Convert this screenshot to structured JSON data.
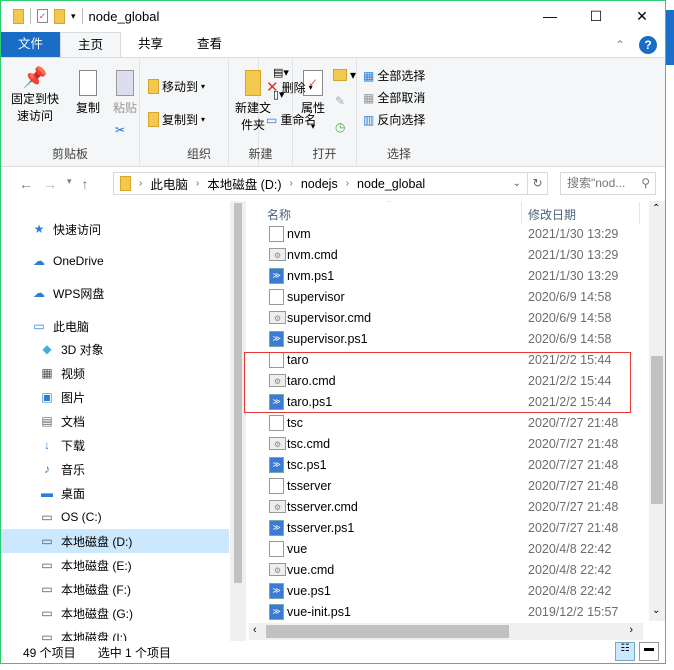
{
  "window": {
    "title": "node_global",
    "minimize": "—",
    "maximize": "☐",
    "close": "✕"
  },
  "tabs": [
    "文件",
    "主页",
    "共享",
    "查看"
  ],
  "ribbon": {
    "clipboard": {
      "label": "剪贴板",
      "pin": "固定到快速访问",
      "copy": "复制",
      "paste": "粘贴"
    },
    "organize": {
      "label": "组织",
      "move": "移动到",
      "copyto": "复制到",
      "delete": "删除",
      "rename": "重命名"
    },
    "new": {
      "label": "新建",
      "folder": "新建文件夹"
    },
    "open": {
      "label": "打开",
      "properties": "属性"
    },
    "select": {
      "label": "选择",
      "all": "全部选择",
      "none": "全部取消",
      "invert": "反向选择"
    }
  },
  "address": {
    "crumbs": [
      "此电脑",
      "本地磁盘 (D:)",
      "nodejs",
      "node_global"
    ],
    "search_placeholder": "搜索\"nod..."
  },
  "sidebar": [
    {
      "label": "快速访问",
      "icon": "★"
    },
    {
      "label": "OneDrive",
      "icon": "☁"
    },
    {
      "label": "WPS网盘",
      "icon": "☁"
    },
    {
      "label": "此电脑",
      "icon": "▭"
    },
    {
      "label": "3D 对象",
      "icon": "◆"
    },
    {
      "label": "视频",
      "icon": "▦"
    },
    {
      "label": "图片",
      "icon": "▣"
    },
    {
      "label": "文档",
      "icon": "▤"
    },
    {
      "label": "下载",
      "icon": "↓"
    },
    {
      "label": "音乐",
      "icon": "♪"
    },
    {
      "label": "桌面",
      "icon": "▬"
    },
    {
      "label": "OS (C:)",
      "icon": "▭"
    },
    {
      "label": "本地磁盘 (D:)",
      "icon": "▭"
    },
    {
      "label": "本地磁盘 (E:)",
      "icon": "▭"
    },
    {
      "label": "本地磁盘 (F:)",
      "icon": "▭"
    },
    {
      "label": "本地磁盘 (G:)",
      "icon": "▭"
    },
    {
      "label": "本地磁盘 (I:)",
      "icon": "▭"
    }
  ],
  "columns": {
    "name": "名称",
    "date": "修改日期"
  },
  "files": [
    {
      "name": "nvm",
      "date": "2021/1/30 13:29",
      "kind": "file"
    },
    {
      "name": "nvm.cmd",
      "date": "2021/1/30 13:29",
      "kind": "cmd"
    },
    {
      "name": "nvm.ps1",
      "date": "2021/1/30 13:29",
      "kind": "ps"
    },
    {
      "name": "supervisor",
      "date": "2020/6/9 14:58",
      "kind": "file"
    },
    {
      "name": "supervisor.cmd",
      "date": "2020/6/9 14:58",
      "kind": "cmd"
    },
    {
      "name": "supervisor.ps1",
      "date": "2020/6/9 14:58",
      "kind": "ps"
    },
    {
      "name": "taro",
      "date": "2021/2/2 15:44",
      "kind": "file"
    },
    {
      "name": "taro.cmd",
      "date": "2021/2/2 15:44",
      "kind": "cmd"
    },
    {
      "name": "taro.ps1",
      "date": "2021/2/2 15:44",
      "kind": "ps"
    },
    {
      "name": "tsc",
      "date": "2020/7/27 21:48",
      "kind": "file"
    },
    {
      "name": "tsc.cmd",
      "date": "2020/7/27 21:48",
      "kind": "cmd"
    },
    {
      "name": "tsc.ps1",
      "date": "2020/7/27 21:48",
      "kind": "ps"
    },
    {
      "name": "tsserver",
      "date": "2020/7/27 21:48",
      "kind": "file"
    },
    {
      "name": "tsserver.cmd",
      "date": "2020/7/27 21:48",
      "kind": "cmd"
    },
    {
      "name": "tsserver.ps1",
      "date": "2020/7/27 21:48",
      "kind": "ps"
    },
    {
      "name": "vue",
      "date": "2020/4/8 22:42",
      "kind": "file"
    },
    {
      "name": "vue.cmd",
      "date": "2020/4/8 22:42",
      "kind": "cmd"
    },
    {
      "name": "vue.ps1",
      "date": "2020/4/8 22:42",
      "kind": "ps"
    },
    {
      "name": "vue-init.ps1",
      "date": "2019/12/2 15:57",
      "kind": "ps"
    }
  ],
  "status": {
    "count": "49 个项目",
    "selected": "选中 1 个项目"
  },
  "colors": {
    "accent": "#1a6dc7",
    "highlight": "#e53935",
    "selection": "#cce8ff"
  }
}
